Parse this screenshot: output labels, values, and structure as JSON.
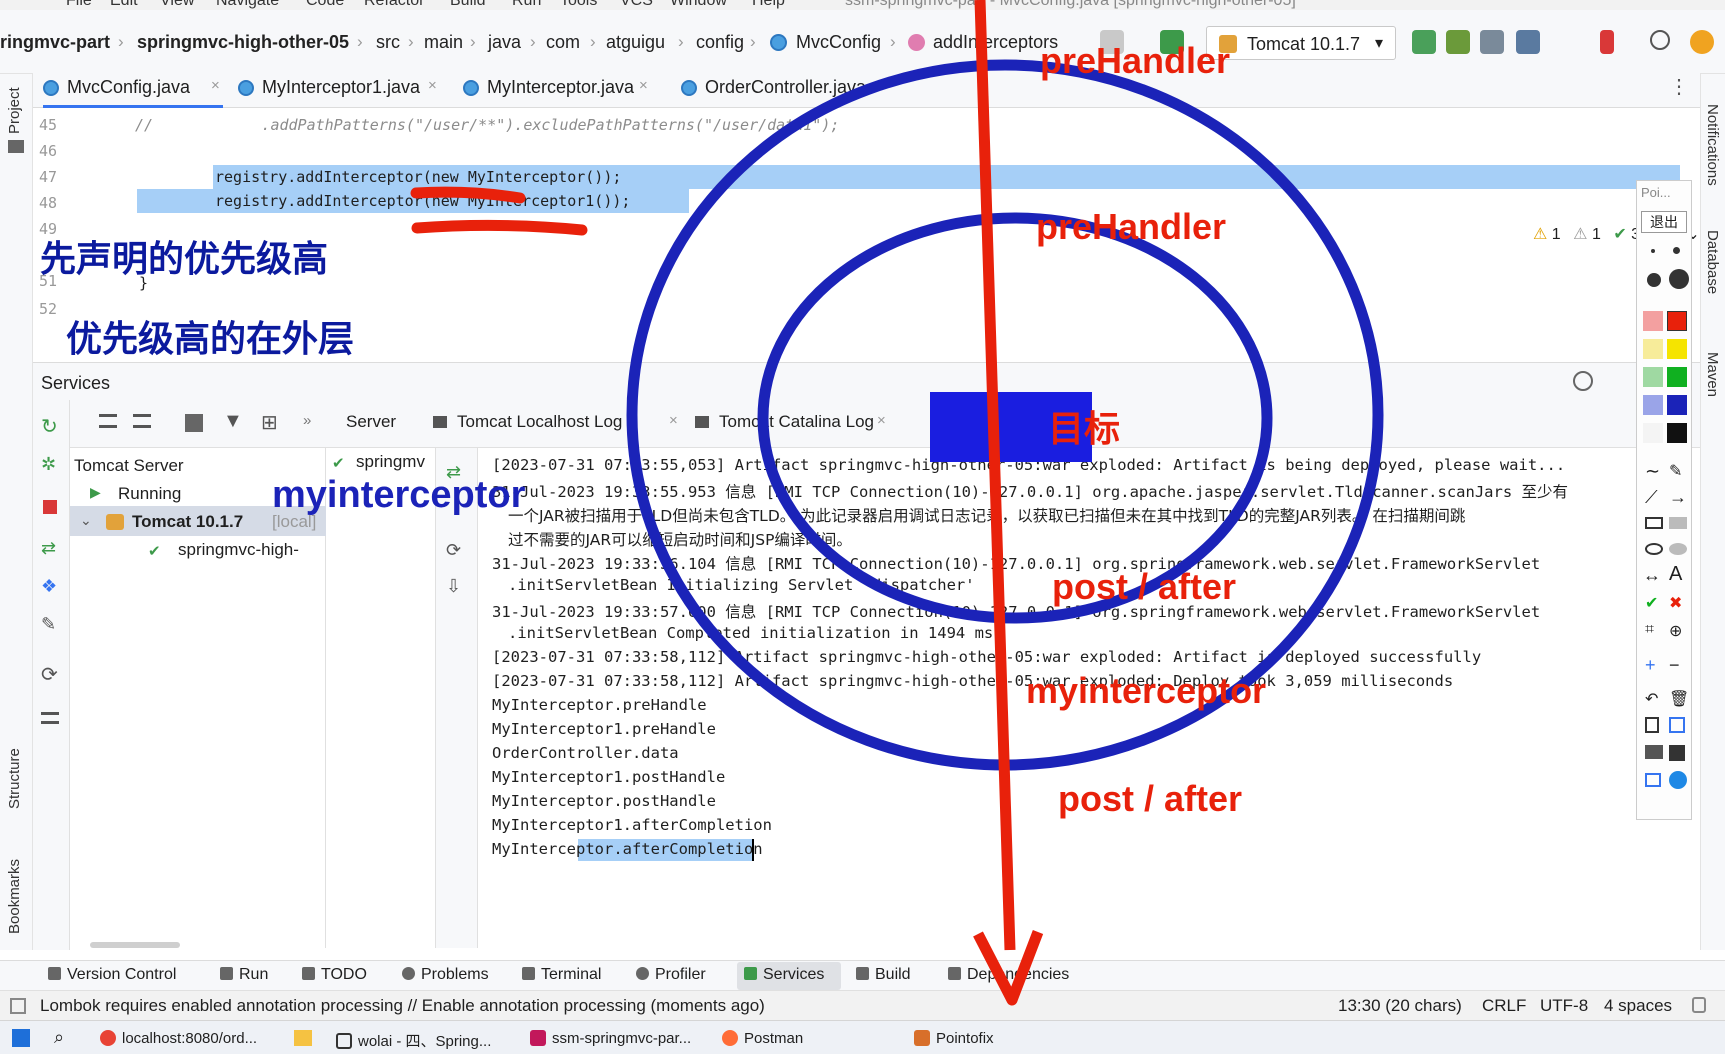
{
  "menu": [
    "File",
    "Edit",
    "View",
    "Navigate",
    "Code",
    "Refactor",
    "Build",
    "Run",
    "Tools",
    "VCS",
    "Window",
    "Help"
  ],
  "window_title": "ssm-springmvc-part - MvcConfig.java [springmvc-high-other-05]",
  "breadcrumbs": [
    "ringmvc-part",
    "springmvc-high-other-05",
    "src",
    "main",
    "java",
    "com",
    "atguigu",
    "config",
    "MvcConfig",
    "addInterceptors"
  ],
  "run_config": "Tomcat 10.1.7",
  "tabs": [
    "MvcConfig.java",
    "MyInterceptor1.java",
    "MyInterceptor.java",
    "OrderController.java"
  ],
  "editor": {
    "line_numbers": [
      "45",
      "46",
      "47",
      "48",
      "49",
      "51",
      "52"
    ],
    "line45": "//            .addPathPatterns(\"/user/**\").excludePathPatterns(\"/user/data1\");",
    "line47": "registry.addInterceptor(new MyInterceptor());",
    "line48": "registry.addInterceptor(new MyInterceptor1());",
    "line51": "}",
    "inspections": {
      "warnings": "1",
      "weak": "1",
      "ok": "3"
    }
  },
  "services": {
    "title": "Services",
    "tree": {
      "server": "Tomcat Server",
      "state": "Running",
      "instance": "Tomcat 10.1.7",
      "instance_tag": "[local]",
      "artifact": "springmvc-high-"
    },
    "server_item": "springmv",
    "tabs": [
      "Server",
      "Tomcat Localhost Log",
      "Tomcat Catalina Log"
    ],
    "log": [
      "[2023-07-31 07:33:55,053] Artifact springmvc-high-other-05:war exploded: Artifact is being deployed, please wait...",
      "31-Jul-2023 19:33:55.953 信息 [RMI TCP Connection(10)-127.0.0.1] org.apache.jasper.servlet.TldScanner.scanJars 至少有",
      "一个JAR被扫描用于TLD但尚未包含TLD。 为此记录器启用调试日志记录，以获取已扫描但未在其中找到TLD的完整JAR列表。 在扫描期间跳",
      "过不需要的JAR可以缩短启动时间和JSP编译时间。",
      "31-Jul-2023 19:33:56.104 信息 [RMI TCP Connection(10)-127.0.0.1] org.springframework.web.servlet.FrameworkServlet",
      ".initServletBean Initializing Servlet 'dispatcher'",
      "31-Jul-2023 19:33:57.600 信息 [RMI TCP Connection(10)-127.0.0.1] org.springframework.web.servlet.FrameworkServlet",
      ".initServletBean Completed initialization in 1494 ms",
      "[2023-07-31 07:33:58,112] Artifact springmvc-high-other-05:war exploded: Artifact is deployed successfully",
      "[2023-07-31 07:33:58,112] Artifact springmvc-high-other-05:war exploded: Deploy took 3,059 milliseconds",
      "MyInterceptor.preHandle",
      "MyInterceptor1.preHandle",
      "OrderController.data",
      "MyInterceptor1.postHandle",
      "MyInterceptor.postHandle",
      "MyInterceptor1.afterCompletion",
      "MyInterceptor.afterCompletion"
    ]
  },
  "tool_windows": [
    "Version Control",
    "Run",
    "TODO",
    "Problems",
    "Terminal",
    "Profiler",
    "Services",
    "Build",
    "Dependencies"
  ],
  "status": {
    "message": "Lombok requires enabled annotation processing // Enable annotation processing (moments ago)",
    "position": "13:30 (20 chars)",
    "line_sep": "CRLF",
    "encoding": "UTF-8",
    "indent": "4 spaces"
  },
  "taskbar": [
    "localhost:8080/ord...",
    "wolai - 四、Spring...",
    "ssm-springmvc-par...",
    "Postman",
    "Pointofix"
  ],
  "side_labels": {
    "left": [
      "Project",
      "Structure",
      "Bookmarks"
    ],
    "right": [
      "Notifications",
      "Database",
      "Maven"
    ]
  },
  "palette": {
    "top": "Poi...",
    "exit": "退出"
  },
  "annotations": {
    "priority_note": "先声明的优先级高",
    "outer_note": "优先级高的在外层",
    "target": "目标",
    "outer_interceptor": "myinterceptor",
    "inner_interceptor": "myinterceptor",
    "pre_outer": "preHandler",
    "pre_inner": "preHandler",
    "post_inner": "post / after",
    "post_outer": "post / after"
  },
  "colors": {
    "annotation_red": "#e8210b",
    "annotation_blue": "#1b23b8",
    "selection": "#a6cff7"
  }
}
